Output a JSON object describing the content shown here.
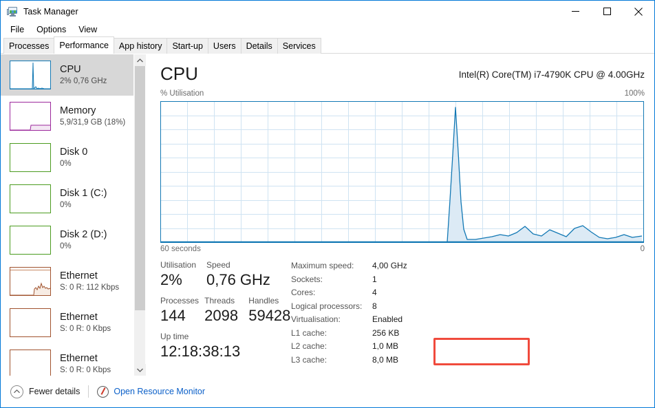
{
  "window": {
    "title": "Task Manager",
    "icon": "task-manager-icon",
    "minimize_label": "–",
    "maximize_label": "□",
    "close_label": "✕"
  },
  "menu": {
    "items": [
      {
        "label": "File"
      },
      {
        "label": "Options"
      },
      {
        "label": "View"
      }
    ]
  },
  "tabs": [
    {
      "label": "Processes",
      "active": false
    },
    {
      "label": "Performance",
      "active": true
    },
    {
      "label": "App history",
      "active": false
    },
    {
      "label": "Start-up",
      "active": false
    },
    {
      "label": "Users",
      "active": false
    },
    {
      "label": "Details",
      "active": false
    },
    {
      "label": "Services",
      "active": false
    }
  ],
  "sidebar": {
    "items": [
      {
        "title": "CPU",
        "sub": "2%  0,76 GHz",
        "color": "#1278b4",
        "selected": true,
        "graph": "cpu-spike"
      },
      {
        "title": "Memory",
        "sub": "5,9/31,9 GB (18%)",
        "color": "#9b279b",
        "selected": false,
        "graph": "memory-step"
      },
      {
        "title": "Disk 0",
        "sub": "0%",
        "color": "#4a9b1e",
        "selected": false,
        "graph": "flat"
      },
      {
        "title": "Disk 1 (C:)",
        "sub": "0%",
        "color": "#4a9b1e",
        "selected": false,
        "graph": "flat"
      },
      {
        "title": "Disk 2 (D:)",
        "sub": "0%",
        "color": "#4a9b1e",
        "selected": false,
        "graph": "flat"
      },
      {
        "title": "Ethernet",
        "sub": "S: 0 R: 112 Kbps",
        "color": "#a0522d",
        "selected": false,
        "graph": "net-active"
      },
      {
        "title": "Ethernet",
        "sub": "S: 0 R: 0 Kbps",
        "color": "#a0522d",
        "selected": false,
        "graph": "flat"
      },
      {
        "title": "Ethernet",
        "sub": "S: 0 R: 0 Kbps",
        "color": "#a0522d",
        "selected": false,
        "graph": "flat"
      }
    ],
    "scroll_up_icon": "chevron-up-icon",
    "scroll_down_icon": "chevron-down-icon"
  },
  "main": {
    "heading": "CPU",
    "model": "Intel(R) Core(TM) i7-4790K CPU @ 4.00GHz",
    "axis_top_left": "% Utilisation",
    "axis_top_right": "100%",
    "axis_bottom_left": "60 seconds",
    "axis_bottom_right": "0",
    "graph_color": "#1278b4",
    "grid_color": "#cfe3f2"
  },
  "chart_data": {
    "type": "area",
    "title": "CPU % Utilisation",
    "xlabel": "60 seconds",
    "ylabel": "% Utilisation",
    "ylim": [
      0,
      100
    ],
    "xlim": [
      0,
      60
    ],
    "grid": true,
    "legend": false,
    "line_color": "#1278b4",
    "fill_color": "#dceaf5",
    "series": [
      {
        "name": "CPU Utilisation",
        "x": [
          35.5,
          36.0,
          36.5,
          37.0,
          37.5,
          38.0,
          38.5,
          39.0,
          40.0,
          41.0,
          42.0,
          43.0,
          44.0,
          45.0,
          46.0,
          47.0,
          48.0,
          49.0,
          50.0,
          51.0,
          52.0,
          53.0,
          54.0,
          55.0,
          56.0,
          57.0,
          58.0,
          59.0,
          60.0
        ],
        "values": [
          0,
          30,
          62,
          96,
          60,
          20,
          9,
          2,
          2,
          2,
          3,
          4,
          5,
          4,
          6,
          9,
          4,
          3,
          7,
          5,
          3,
          8,
          10,
          6,
          2,
          2,
          3,
          5,
          3
        ]
      }
    ]
  },
  "stats": {
    "left": [
      {
        "name": "Utilisation",
        "value": "2%"
      },
      {
        "name": "Speed",
        "value": "0,76 GHz"
      },
      {
        "name": "Processes",
        "value": "144"
      },
      {
        "name": "Threads",
        "value": "2098"
      },
      {
        "name": "Handles",
        "value": "59428"
      },
      {
        "name": "Up time",
        "value": "12:18:38:13"
      }
    ],
    "right": [
      {
        "key": "Maximum speed:",
        "value": "4,00 GHz",
        "highlighted": false
      },
      {
        "key": "Sockets:",
        "value": "1",
        "highlighted": false
      },
      {
        "key": "Cores:",
        "value": "4",
        "highlighted": true
      },
      {
        "key": "Logical processors:",
        "value": "8",
        "highlighted": true
      },
      {
        "key": "Virtualisation:",
        "value": "Enabled",
        "highlighted": false
      },
      {
        "key": "L1 cache:",
        "value": "256 KB",
        "highlighted": false
      },
      {
        "key": "L2 cache:",
        "value": "1,0 MB",
        "highlighted": false
      },
      {
        "key": "L3 cache:",
        "value": "8,0 MB",
        "highlighted": false
      }
    ],
    "highlight_color": "#f04a3c"
  },
  "statusbar": {
    "fewer_details_label": "Fewer details",
    "fewer_details_icon": "chevron-up-circle-icon",
    "resource_monitor_label": "Open Resource Monitor",
    "resource_monitor_icon": "resource-monitor-icon"
  }
}
